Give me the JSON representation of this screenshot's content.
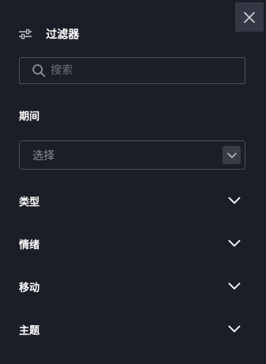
{
  "panel": {
    "title": "过滤器",
    "title_icon": "sliders-icon",
    "close_icon": "close-icon"
  },
  "search": {
    "placeholder": "搜索",
    "value": "",
    "icon": "search-icon"
  },
  "period": {
    "label": "期间",
    "select_value": "选择",
    "icon": "chevron-down-icon"
  },
  "sections": [
    {
      "label": "类型",
      "icon": "chevron-down-icon"
    },
    {
      "label": "情绪",
      "icon": "chevron-down-icon"
    },
    {
      "label": "移动",
      "icon": "chevron-down-icon"
    },
    {
      "label": "主题",
      "icon": "chevron-down-icon"
    }
  ],
  "colors": {
    "background": "#1c1e27",
    "border": "#4b4e5a",
    "close_button_bg": "#353844",
    "select_chevron_bg": "#3a3d48",
    "text": "#ffffff",
    "muted_text": "#8d909b"
  }
}
